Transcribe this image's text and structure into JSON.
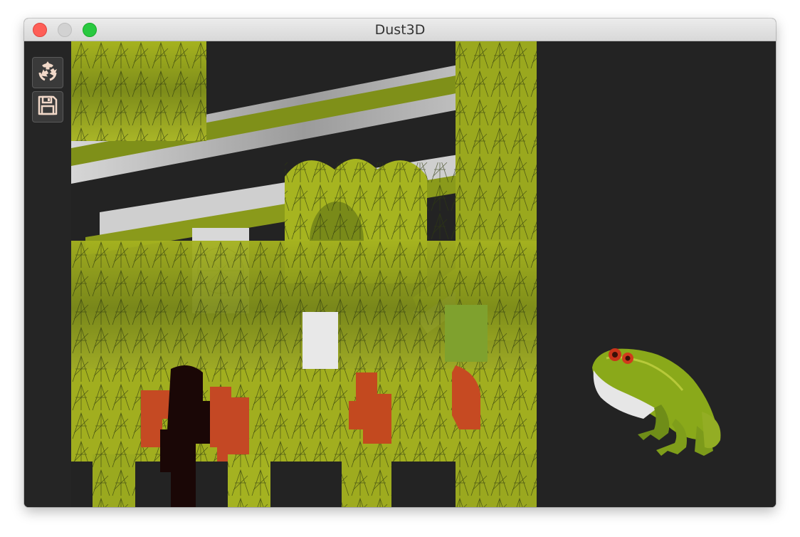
{
  "window": {
    "title": "Dust3D"
  },
  "toolbar": {
    "buttons": [
      {
        "icon": "recycle-icon"
      },
      {
        "icon": "save-icon"
      }
    ]
  },
  "colors": {
    "background": "#252525",
    "texture_green": "#9aa818",
    "texture_dark_green": "#6f7d1a",
    "texture_gray": "#b5b5b5",
    "texture_red": "#c84a22",
    "wireframe_mint": "#9de5c8",
    "frog_green": "#7fa21c"
  }
}
